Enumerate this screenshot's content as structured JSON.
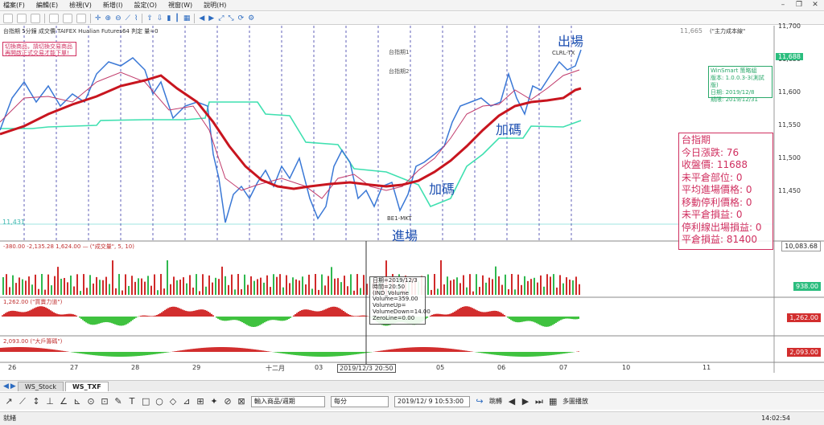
{
  "menu": [
    "檔案(F)",
    "編輯(E)",
    "檢視(V)",
    "新增(I)",
    "設定(O)",
    "視窗(W)",
    "說明(H)"
  ],
  "indicator_row": {
    "left": "台指期 5分鐘 成交價 TAIFEX Hualian Futures64 判定 量=0",
    "right": "(\"主力成本線\""
  },
  "left_notice": "切換商品，請切換交易商品\n再開啟正式交易才能下單!",
  "price_axis": [
    "11,700",
    "11,650",
    "11,600",
    "11,550",
    "11,500",
    "11,450"
  ],
  "price_badges": {
    "green": "11,688",
    "top": "11,665"
  },
  "left_axis_value": "11,431",
  "strategy_labels": [
    "台指期1",
    "台指期2"
  ],
  "info_panel": {
    "title": "台指期",
    "lines": [
      "今日漲跌: 76",
      "收盤價: 11688",
      "未平倉部位: 0",
      "平均進場價格: 0",
      "移動停利價格: 0",
      "未平倉損益: 0",
      "停利線出場損益: 0",
      "平倉損益: 81400"
    ]
  },
  "version_box": [
    "WinSmart 策略組",
    "版本: 1.0.0.3-3(測試版)",
    "日期: 2019/12/8",
    "期限: 2019/12/31"
  ],
  "annotations": {
    "exit": "出場",
    "add1": "加碼",
    "add2": "加碼",
    "entry": "進場",
    "exit_marker": "CLRL-TX",
    "entry_marker": "BE1-MKT"
  },
  "volume_header": "-380.00 -2,135.28 1,624.00 — (\"成交量\", 5, 10)",
  "volume_value": "10,083.68",
  "volume_value2": "938.00",
  "panel3_header": "1,262.00 (\"買賣力道\")",
  "panel3_value": "1,262.00",
  "panel4_header": "2,093.00 (\"大戶籌碼\")",
  "panel4_value": "2,093.00",
  "tooltip": [
    "日期=2019/12/3",
    "時間=20:50",
    "(IND_Volume",
    "Volume=359.00",
    "VolumeUp=",
    "VolumeDown=14.00",
    "ZeroLine=0.00"
  ],
  "date_axis": [
    "26",
    "27",
    "28",
    "29",
    "十二月",
    "03",
    "2019/12/3 20:50",
    "05",
    "06",
    "07",
    "10",
    "11"
  ],
  "tabs": [
    "WS_Stock",
    "WS_TXF"
  ],
  "draw_tools": [
    "↗",
    "⟋",
    "↕",
    "⊥",
    "∠",
    "⊾",
    "⊙",
    "⊡",
    "✎",
    "T",
    "□",
    "○",
    "◇",
    "⊿",
    "⊞",
    "✦",
    "⊘",
    "⊠"
  ],
  "symbol_input": "輸入商品/週期",
  "period_select": "每分",
  "datetime_input": "2019/12/ 9 10:53:00",
  "jump_label": "跳轉",
  "multi_chart_label": "多圖播放",
  "status_left": "就緒",
  "status_time": "14:02:54",
  "chart_data": {
    "type": "line",
    "series": [
      {
        "name": "",
        "color": "#2e6fd0"
      },
      {
        "name": "",
        "color": "#cc1f2a"
      },
      {
        "name": "",
        "color": "#2ecc9a"
      }
    ],
    "ylim": [
      11420,
      11720
    ]
  }
}
